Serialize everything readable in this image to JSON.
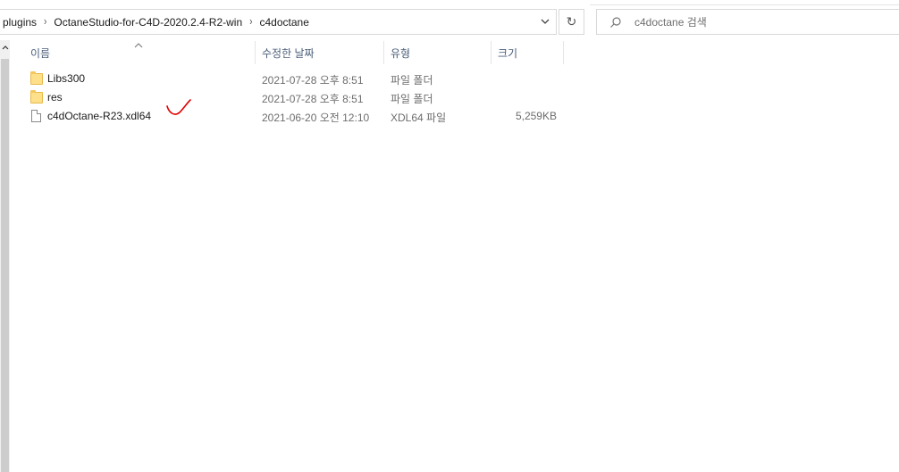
{
  "address_bar": {
    "breadcrumbs": [
      "plugins",
      "OctaneStudio-for-C4D-2020.2.4-R2-win",
      "c4doctane"
    ]
  },
  "search": {
    "placeholder": "c4doctane 검색"
  },
  "columns": {
    "name": "이름",
    "date": "수정한 날짜",
    "type": "유형",
    "size": "크기"
  },
  "files": [
    {
      "name": "Libs300",
      "date": "2021-07-28 오후 8:51",
      "type": "파일 폴더",
      "size": "",
      "icon": "folder-icon"
    },
    {
      "name": "res",
      "date": "2021-07-28 오후 8:51",
      "type": "파일 폴더",
      "size": "",
      "icon": "folder-icon"
    },
    {
      "name": "c4dOctane-R23.xdl64",
      "date": "2021-06-20 오전 12:10",
      "type": "XDL64 파일",
      "size": "5,259KB",
      "icon": "file-icon"
    }
  ],
  "colors": {
    "header_text": "#4c607a",
    "folder": "#ffe08a",
    "annotation": "#e00000"
  }
}
